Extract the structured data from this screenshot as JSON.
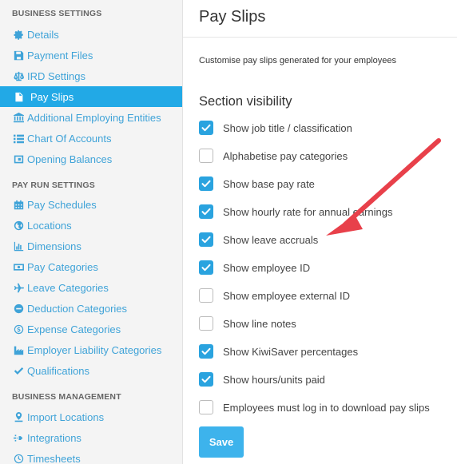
{
  "sidebar": {
    "business_settings": {
      "heading": "BUSINESS SETTINGS",
      "items": [
        {
          "label": "Details",
          "icon": "gear-icon"
        },
        {
          "label": "Payment Files",
          "icon": "save-icon"
        },
        {
          "label": "IRD Settings",
          "icon": "scales-icon"
        },
        {
          "label": "Pay Slips",
          "icon": "document-icon",
          "active": true
        },
        {
          "label": "Additional Employing Entities",
          "icon": "bank-icon"
        },
        {
          "label": "Chart Of Accounts",
          "icon": "list-icon"
        },
        {
          "label": "Opening Balances",
          "icon": "wallet-icon"
        }
      ]
    },
    "pay_run_settings": {
      "heading": "PAY RUN SETTINGS",
      "items": [
        {
          "label": "Pay Schedules",
          "icon": "calendar-icon"
        },
        {
          "label": "Locations",
          "icon": "globe-icon"
        },
        {
          "label": "Dimensions",
          "icon": "bar-chart-icon"
        },
        {
          "label": "Pay Categories",
          "icon": "money-icon"
        },
        {
          "label": "Leave Categories",
          "icon": "plane-icon"
        },
        {
          "label": "Deduction Categories",
          "icon": "minus-circle-icon"
        },
        {
          "label": "Expense Categories",
          "icon": "dollar-circle-icon"
        },
        {
          "label": "Employer Liability Categories",
          "icon": "industry-icon"
        },
        {
          "label": "Qualifications",
          "icon": "check-icon"
        }
      ]
    },
    "business_management": {
      "heading": "BUSINESS MANAGEMENT",
      "items": [
        {
          "label": "Import Locations",
          "icon": "map-pin-icon"
        },
        {
          "label": "Integrations",
          "icon": "plug-icon"
        },
        {
          "label": "Timesheets",
          "icon": "clock-icon"
        }
      ]
    }
  },
  "main": {
    "title": "Pay Slips",
    "subtitle": "Customise pay slips generated for your employees",
    "section_title": "Section visibility",
    "options": [
      {
        "label": "Show job title / classification",
        "checked": true
      },
      {
        "label": "Alphabetise pay categories",
        "checked": false
      },
      {
        "label": "Show base pay rate",
        "checked": true
      },
      {
        "label": "Show hourly rate for annual earnings",
        "checked": true
      },
      {
        "label": "Show leave accruals",
        "checked": true
      },
      {
        "label": "Show employee ID",
        "checked": true
      },
      {
        "label": "Show employee external ID",
        "checked": false
      },
      {
        "label": "Show line notes",
        "checked": false
      },
      {
        "label": "Show KiwiSaver percentages",
        "checked": true
      },
      {
        "label": "Show hours/units paid",
        "checked": true
      },
      {
        "label": "Employees must log in to download pay slips",
        "checked": false
      }
    ],
    "save_label": "Save"
  },
  "colors": {
    "accent": "#22a9e6",
    "link": "#3fa3d8",
    "checkbox": "#2aa3df",
    "annotation_arrow": "#e8404a"
  }
}
